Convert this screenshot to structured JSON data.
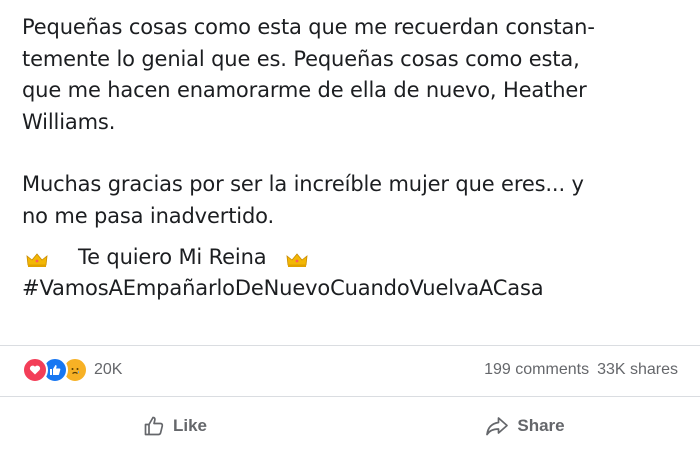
{
  "post": {
    "lines": [
      "Pequeñas cosas como esta que me recuerdan constan-",
      "temente lo genial que es. Pequeñas cosas como esta,",
      "que me hacen enamorarme de ella de nuevo, Heather",
      "Williams."
    ],
    "lines2": [
      "Muchas gracias por ser la increíble mujer que eres... y",
      "no me pasa inadvertido."
    ],
    "reina": "Te quiero Mi Reina",
    "hashtag": "#VamosAEmpañarloDeNuevoCuandoVuelvaACasa"
  },
  "stats": {
    "reaction_icons": [
      "love-icon",
      "like-icon",
      "sad-icon"
    ],
    "reaction_count": "20K",
    "comments": "199 comments",
    "shares": "33K shares"
  },
  "actions": {
    "like_label": "Like",
    "share_label": "Share"
  },
  "colors": {
    "text": "#1c1e21",
    "muted": "#65676b",
    "love": "#f33e58",
    "like": "#1877f2",
    "sad": "#f7b125",
    "crown": "#f2b705"
  }
}
